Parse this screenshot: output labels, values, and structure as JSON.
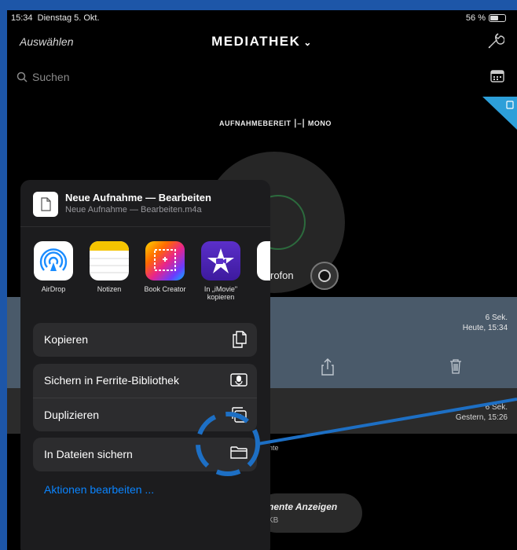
{
  "status_bar": {
    "time": "15:34",
    "date": "Dienstag 5. Okt.",
    "battery": "56 %",
    "battery_level": 0.56
  },
  "navbar": {
    "select": "Auswählen",
    "title": "MEDIATHEK",
    "title_icon": "chevron-down-icon",
    "settings_icon": "wrench-icon"
  },
  "search": {
    "placeholder": "Suchen"
  },
  "recorder": {
    "status": "AUFNAHMEBEREIT",
    "channel": "MONO",
    "mic_fragment": "rofon"
  },
  "recordings": [
    {
      "duration": "6 Sek.",
      "date": "Heute, 15:34"
    },
    {
      "duration": "6 Sek.",
      "date": "Gestern, 15:26"
    }
  ],
  "fragments": {
    "row_tail": "nte",
    "show_all": "nente Anzeigen",
    "size": "KB"
  },
  "share_sheet": {
    "file_title": "Neue Aufnahme — Bearbeiten",
    "file_subtitle": "Neue Aufnahme — Bearbeiten.m4a",
    "apps": [
      {
        "label": "AirDrop",
        "icon": "airdrop-icon"
      },
      {
        "label": "Notizen",
        "icon": "notes-icon"
      },
      {
        "label": "Book Creator",
        "icon": "book-creator-icon"
      },
      {
        "label": "In „iMovie\"\nkopieren",
        "icon": "imovie-icon"
      }
    ],
    "actions": {
      "copy": "Kopieren",
      "save_ferrite": "Sichern in Ferrite-Bibliothek",
      "duplicate": "Duplizieren",
      "save_files": "In Dateien sichern",
      "edit": "Aktionen bearbeiten ..."
    }
  },
  "colors": {
    "accent": "#0a84ff",
    "annotation": "#1d6fc4",
    "frame": "#1d56a8"
  }
}
